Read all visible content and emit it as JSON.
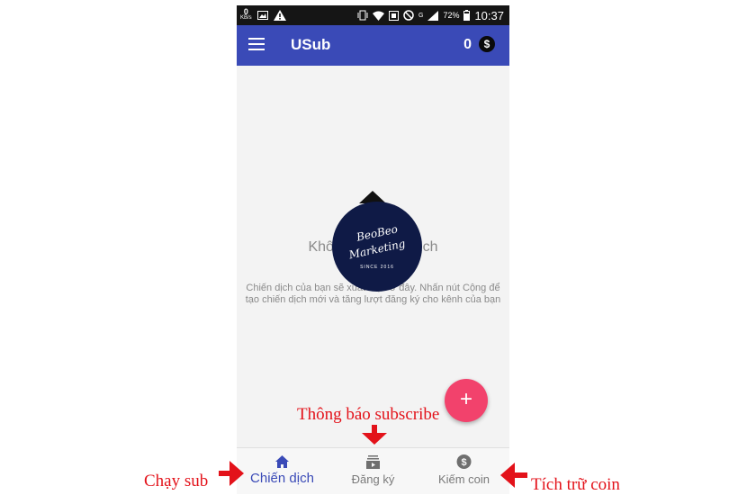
{
  "status_bar": {
    "net_speed_value": "0",
    "net_speed_unit": "KB/s",
    "network_type": "G",
    "battery_percent": "72%",
    "time": "10:37"
  },
  "app_bar": {
    "title": "USub",
    "coin_count": "0",
    "coin_symbol": "$"
  },
  "empty_state": {
    "title": "Không có chiến dịch",
    "description": "Chiến dịch của bạn sẽ xuất hiện ở đây. Nhấn nút Cộng để tạo chiến dịch mới và tăng lượt đăng ký cho kênh của bạn"
  },
  "watermark": {
    "line1": "BeoBeo",
    "line2": "Marketing",
    "line3": "SINCE 2016"
  },
  "fab": {
    "symbol": "+"
  },
  "bottom_nav": {
    "items": [
      {
        "label": "Chiến dịch",
        "icon": "home-icon",
        "active": true
      },
      {
        "label": "Đăng ký",
        "icon": "subscriptions-icon",
        "active": false
      },
      {
        "label": "Kiếm coin",
        "icon": "dollar-coin-icon",
        "active": false
      }
    ]
  },
  "annotations": {
    "left": "Chạy sub",
    "center": "Thông báo subscribe",
    "right": "Tích trữ coin",
    "color": "#e3121a"
  },
  "colors": {
    "app_bar": "#3a4ab7",
    "fab": "#f2426c",
    "active_nav": "#3a4ab7"
  }
}
